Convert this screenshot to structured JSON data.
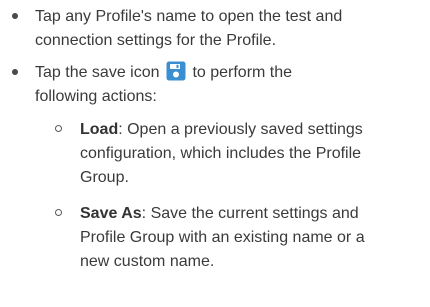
{
  "bullets": [
    {
      "line1": "Tap any Profile's name to open the test and",
      "line2": "connection settings for the Profile."
    },
    {
      "line1_before_icon": "Tap the save icon",
      "line1_after_icon": "to perform the",
      "line2": "following actions:",
      "icon": "save-icon",
      "icon_color": "#3a8fd0"
    }
  ],
  "sub_bullets": [
    {
      "term": "Load",
      "line1_rest": ": Open a previously saved settings",
      "line2": "configuration, which includes the Profile",
      "line3": "Group."
    },
    {
      "term": "Save As",
      "line1_rest": ": Save the current settings and",
      "line2": "Profile Group with an existing name or a",
      "line3": "new custom name."
    }
  ]
}
